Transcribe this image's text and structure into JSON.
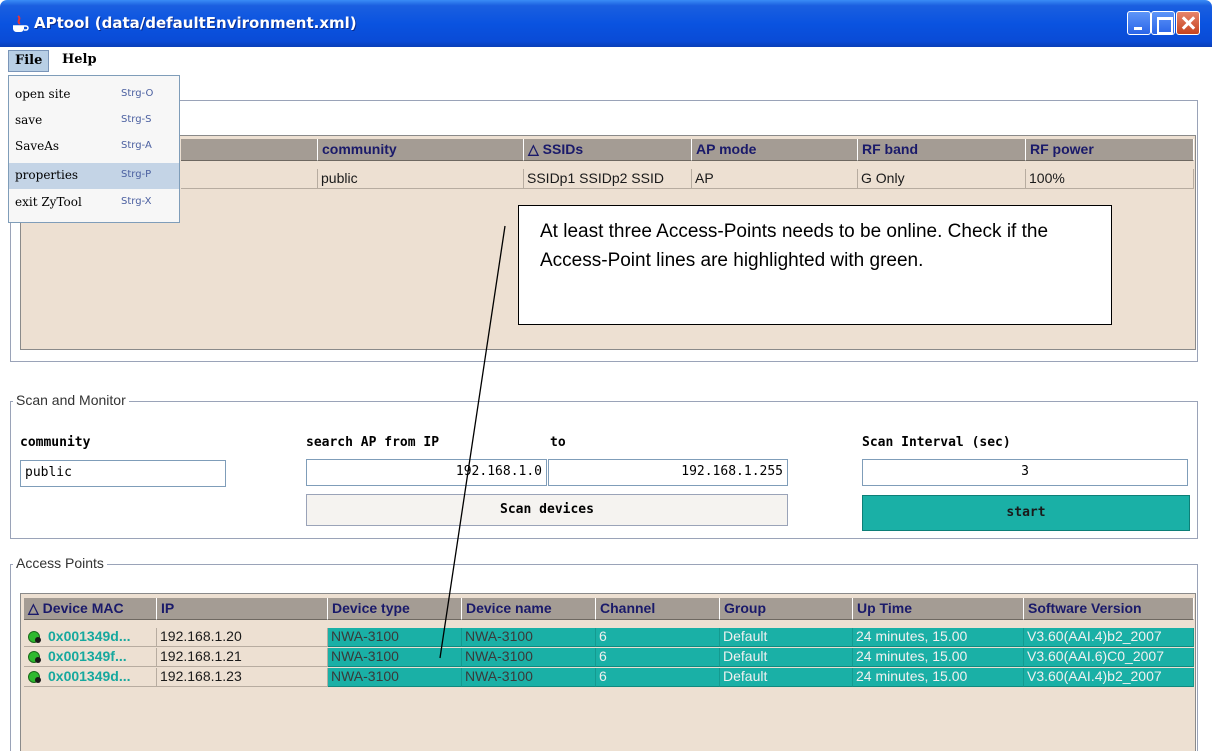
{
  "window": {
    "title": "APtool (data/defaultEnvironment.xml)"
  },
  "menubar": {
    "file": "File",
    "help": "Help"
  },
  "file_menu": {
    "items": [
      {
        "label": "open site",
        "shortcut": "Strg-O"
      },
      {
        "label": "save",
        "shortcut": "Strg-S"
      },
      {
        "label": "SaveAs",
        "shortcut": "Strg-A"
      },
      {
        "label": "properties",
        "shortcut": "Strg-P",
        "selected": true
      },
      {
        "label": "exit ZyTool",
        "shortcut": "Strg-X"
      }
    ]
  },
  "site_table": {
    "headers": [
      "community",
      "SSIDs",
      "AP mode",
      "RF band",
      "RF power"
    ],
    "sort_indicator": "△",
    "row": [
      "public",
      "SSIDp1 SSIDp2 SSID",
      "AP",
      "G Only",
      "100%"
    ]
  },
  "callout": {
    "text": "At least three Access-Points needs to be online. Check if the Access-Point lines are highlighted with green."
  },
  "scan": {
    "group_title": "Scan and Monitor",
    "community_label": "community",
    "community_value": "public",
    "search_from_label": "search AP from IP",
    "to_label": "to",
    "ip_from": "192.168.1.0",
    "ip_to": "192.168.1.255",
    "interval_label": "Scan Interval (sec)",
    "interval_value": "3",
    "scan_button": "Scan devices",
    "start_button": "start"
  },
  "access_points": {
    "group_title": "Access Points",
    "headers": [
      "Device MAC",
      "IP",
      "Device type",
      "Device name",
      "Channel",
      "Group",
      "Up Time",
      "Software Version"
    ],
    "sort_indicator": "△",
    "rows": [
      [
        "0x001349d...",
        "192.168.1.20",
        "NWA-3100",
        "NWA-3100",
        "6",
        "Default",
        "24 minutes, 15.00",
        "V3.60(AAI.4)b2_2007"
      ],
      [
        "0x001349f...",
        "192.168.1.21",
        "NWA-3100",
        "NWA-3100",
        "6",
        "Default",
        "24 minutes, 15.00",
        "V3.60(AAI.6)C0_2007"
      ],
      [
        "0x001349d...",
        "192.168.1.23",
        "NWA-3100",
        "NWA-3100",
        "6",
        "Default",
        "24 minutes, 15.00",
        "V3.60(AAI.4)b2_2007"
      ]
    ]
  },
  "colors": {
    "online_row": "#1ab0a6",
    "panel_bg": "#ede0d2",
    "header_bg": "#a49c94",
    "titlebar": "#0a53e0"
  },
  "icons": {
    "status": "status-online-icon"
  }
}
